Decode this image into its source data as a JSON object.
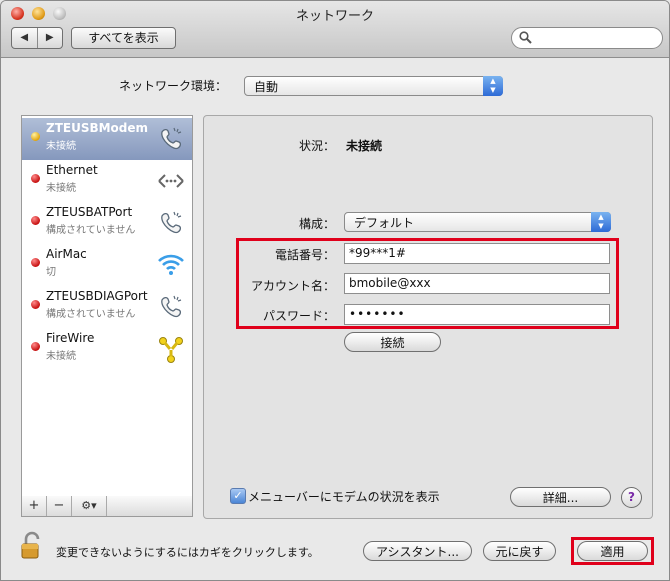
{
  "window": {
    "title": "ネットワーク"
  },
  "toolbar": {
    "back_label": "◀",
    "forward_label": "▶",
    "show_all_label": "すべてを表示",
    "search_placeholder": ""
  },
  "location": {
    "label": "ネットワーク環境：",
    "value": "自動"
  },
  "services": [
    {
      "name": "ZTEUSBModem",
      "status": "未接続",
      "selected": true,
      "status_color": "yellow",
      "icon": "phone-modem-icon"
    },
    {
      "name": "Ethernet",
      "status": "未接続",
      "selected": false,
      "status_color": "red",
      "icon": "ethernet-icon"
    },
    {
      "name": "ZTEUSBATPort",
      "status": "構成されていません",
      "selected": false,
      "status_color": "red",
      "icon": "phone-modem-icon"
    },
    {
      "name": "AirMac",
      "status": "切",
      "selected": false,
      "status_color": "red",
      "icon": "wifi-icon"
    },
    {
      "name": "ZTEUSBDIAGPort",
      "status": "構成されていません",
      "selected": false,
      "status_color": "red",
      "icon": "phone-modem-icon"
    },
    {
      "name": "FireWire",
      "status": "未接続",
      "selected": false,
      "status_color": "red",
      "icon": "firewire-icon"
    }
  ],
  "sidebar_toolbar": {
    "add": "+",
    "remove": "−",
    "action": "⚙▾"
  },
  "detail": {
    "status_label": "状況：",
    "status_value": "未接続",
    "config_label": "構成：",
    "config_value": "デフォルト",
    "phone_label": "電話番号：",
    "phone_value": "*99***1#",
    "account_label": "アカウント名：",
    "account_value": "bmobile@xxx",
    "password_label": "パスワード：",
    "password_value": "•••••••",
    "connect_label": "接続",
    "menubar_checkbox_label": "メニューバーにモデムの状況を表示",
    "menubar_checked": true,
    "advanced_label": "詳細...",
    "help_label": "?"
  },
  "footer": {
    "lock_message": "変更できないようにするにはカギをクリックします。",
    "assistant_label": "アシスタント...",
    "revert_label": "元に戻す",
    "apply_label": "適用"
  },
  "colors": {
    "highlight_box": "#e0001b",
    "selection": "#8598bd"
  }
}
